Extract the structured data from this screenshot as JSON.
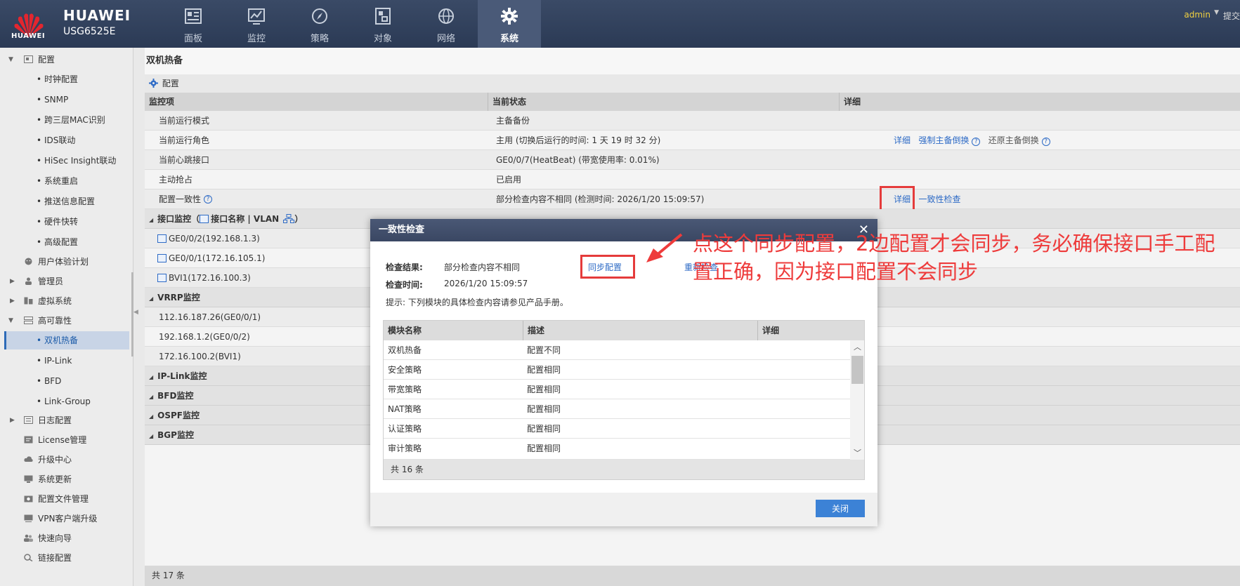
{
  "header": {
    "logo_text": "HUAWEI",
    "brand": "HUAWEI",
    "model": "USG6525E",
    "user": "admin",
    "submit": "提交",
    "nav": [
      {
        "label": "面板"
      },
      {
        "label": "监控"
      },
      {
        "label": "策略"
      },
      {
        "label": "对象"
      },
      {
        "label": "网络"
      },
      {
        "label": "系统"
      }
    ]
  },
  "sidebar": {
    "items": [
      {
        "label": "配置"
      },
      {
        "label": "时钟配置"
      },
      {
        "label": "SNMP"
      },
      {
        "label": "跨三层MAC识别"
      },
      {
        "label": "IDS联动"
      },
      {
        "label": "HiSec Insight联动"
      },
      {
        "label": "系统重启"
      },
      {
        "label": "推送信息配置"
      },
      {
        "label": "硬件快转"
      },
      {
        "label": "高级配置"
      },
      {
        "label": "用户体验计划"
      },
      {
        "label": "管理员"
      },
      {
        "label": "虚拟系统"
      },
      {
        "label": "高可靠性"
      },
      {
        "label": "双机热备"
      },
      {
        "label": "IP-Link"
      },
      {
        "label": "BFD"
      },
      {
        "label": "Link-Group"
      },
      {
        "label": "日志配置"
      },
      {
        "label": "License管理"
      },
      {
        "label": "升级中心"
      },
      {
        "label": "系统更新"
      },
      {
        "label": "配置文件管理"
      },
      {
        "label": "VPN客户端升级"
      },
      {
        "label": "快速向导"
      },
      {
        "label": "链接配置"
      }
    ]
  },
  "main": {
    "title": "双机热备",
    "config_label": "配置",
    "columns": {
      "c1": "监控项",
      "c2": "当前状态",
      "c3": "详细"
    },
    "rows": [
      {
        "item": "当前运行模式",
        "status": "主备备份"
      },
      {
        "item": "当前运行角色",
        "status": "主用 (切换后运行的时间: 1 天 19 时 32 分)",
        "detail": "详细",
        "force": "强制主备倒换",
        "restore": "还原主备倒换"
      },
      {
        "item": "当前心跳接口",
        "status": "GE0/0/7(HeatBeat) (带宽使用率: 0.01%)"
      },
      {
        "item": "主动抢占",
        "status": "已启用"
      },
      {
        "item": "配置一致性",
        "status": "部分检查内容不相同 (检测时间: 2026/1/20 15:09:57)",
        "detail": "详细",
        "check": "一致性检查"
      }
    ],
    "interface_section": {
      "title": "接口监控",
      "paren_open": "（",
      "subtitle": "接口名称 | VLAN",
      "paren_close": "）"
    },
    "interfaces": [
      "GE0/0/2(192.168.1.3)",
      "GE0/0/1(172.16.105.1)",
      "BVI1(172.16.100.3)"
    ],
    "vrrp_section": "VRRP监控",
    "vrrp": [
      "112.16.187.26(GE0/0/1)",
      "192.168.1.2(GE0/0/2)",
      "172.16.100.2(BVI1)"
    ],
    "sections": [
      "IP-Link监控",
      "BFD监控",
      "OSPF监控",
      "BGP监控"
    ],
    "footer": "共 17 条"
  },
  "modal": {
    "title": "一致性检查",
    "result_label": "检查结果:",
    "result_value": "部分检查内容不相同",
    "sync_button": "同步配置",
    "recheck": "重新检查",
    "time_label": "检查时间:",
    "time_value": "2026/1/20 15:09:57",
    "tip": "提示: 下列模块的具体检查内容请参见产品手册。",
    "columns": {
      "a": "模块名称",
      "b": "描述",
      "c": "详细"
    },
    "rows": [
      {
        "name": "双机热备",
        "desc": "配置不同"
      },
      {
        "name": "安全策略",
        "desc": "配置相同"
      },
      {
        "name": "带宽策略",
        "desc": "配置相同"
      },
      {
        "name": "NAT策略",
        "desc": "配置相同"
      },
      {
        "name": "认证策略",
        "desc": "配置相同"
      },
      {
        "name": "审计策略",
        "desc": "配置相同"
      }
    ],
    "total": "共 16 条",
    "close": "关闭"
  },
  "annotation": {
    "line1": "点这个同步配置，2边配置才会同步，务必确保接口手工配",
    "line2": "置正确，因为接口配置不会同步"
  },
  "colors": {
    "accent": "#2e6bc6",
    "header": "#2b3a55",
    "annotation": "#ee3b3b"
  }
}
